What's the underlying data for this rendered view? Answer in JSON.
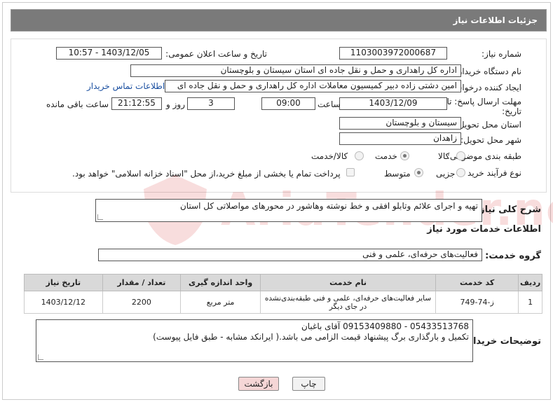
{
  "header": {
    "title": "جزئیات اطلاعات نیاز"
  },
  "fields": {
    "need_number_label": "شماره نیاز:",
    "need_number": "1103003972000687",
    "announce_label": "تاریخ و ساعت اعلان عمومی:",
    "announce_value": "1403/12/05 - 10:57",
    "buyer_label": "نام دستگاه خریدار:",
    "buyer_value": "اداره کل راهداری و حمل و نقل جاده ای استان سیستان و بلوچستان",
    "creator_label": "ایجاد کننده درخواست:",
    "creator_value": "امین دشتی زاده دبیر کمیسیون معاملات اداره کل راهداری و حمل و نقل جاده ای",
    "contact_link": "اطلاعات تماس خریدار",
    "deadline_label_1": "مهلت ارسال پاسخ: تا",
    "deadline_label_2": "تاریخ:",
    "deadline_date": "1403/12/09",
    "time_label": "ساعت",
    "deadline_time": "09:00",
    "days_value": "3",
    "days_label": "روز و",
    "remaining_time": "21:12:55",
    "remaining_label": "ساعت باقی مانده",
    "province_label": "استان محل تحویل:",
    "province_value": "سیستان و بلوچستان",
    "city_label": "شهر محل تحویل:",
    "city_value": "زاهدان",
    "category_label": "طبقه بندی موضوعی:",
    "category_options": [
      "کالا",
      "خدمت",
      "کالا/خدمت"
    ],
    "category_selected": 1,
    "process_label": "نوع فرآیند خرید :",
    "process_options": [
      "جزیی",
      "متوسط"
    ],
    "process_selected": 1,
    "payment_note": "پرداخت تمام یا بخشی از مبلغ خرید،از محل \"اسناد خزانه اسلامی\" خواهد بود."
  },
  "description": {
    "label": "شرح کلی نیاز:",
    "value": "تهیه و اجرای علائم وتابلو افقی و خط نوشته وهاشور در محورهای مواصلاتی کل استان"
  },
  "services": {
    "section_title": "اطلاعات خدمات مورد نیاز",
    "group_label": "گروه خدمت:",
    "group_value": "فعالیت‌های حرفه‌ای، علمی و فنی",
    "columns": [
      "ردیف",
      "کد خدمت",
      "نام خدمت",
      "واحد اندازه گیری",
      "تعداد / مقدار",
      "تاریخ نیاز"
    ],
    "rows": [
      [
        "1",
        "ز-74-749",
        "سایر فعالیت‌های حرفه‌ای، علمی و فنی طبقه‌بندی‌نشده در جای دیگر",
        "متر مربع",
        "2200",
        "1403/12/12"
      ]
    ]
  },
  "buyer_notes": {
    "label": "توضیحات خریدار:",
    "line1": "05433513768 - 09153409880 آقای باغبان",
    "line2": "تکمیل و بارگذاری برگ پیشنهاد قیمت الزامی می باشد.( ایرانکد مشابه - طبق فایل پیوست)"
  },
  "buttons": {
    "print": "چاپ",
    "back": "بازگشت"
  },
  "watermark_text": "AriaTender.neT"
}
